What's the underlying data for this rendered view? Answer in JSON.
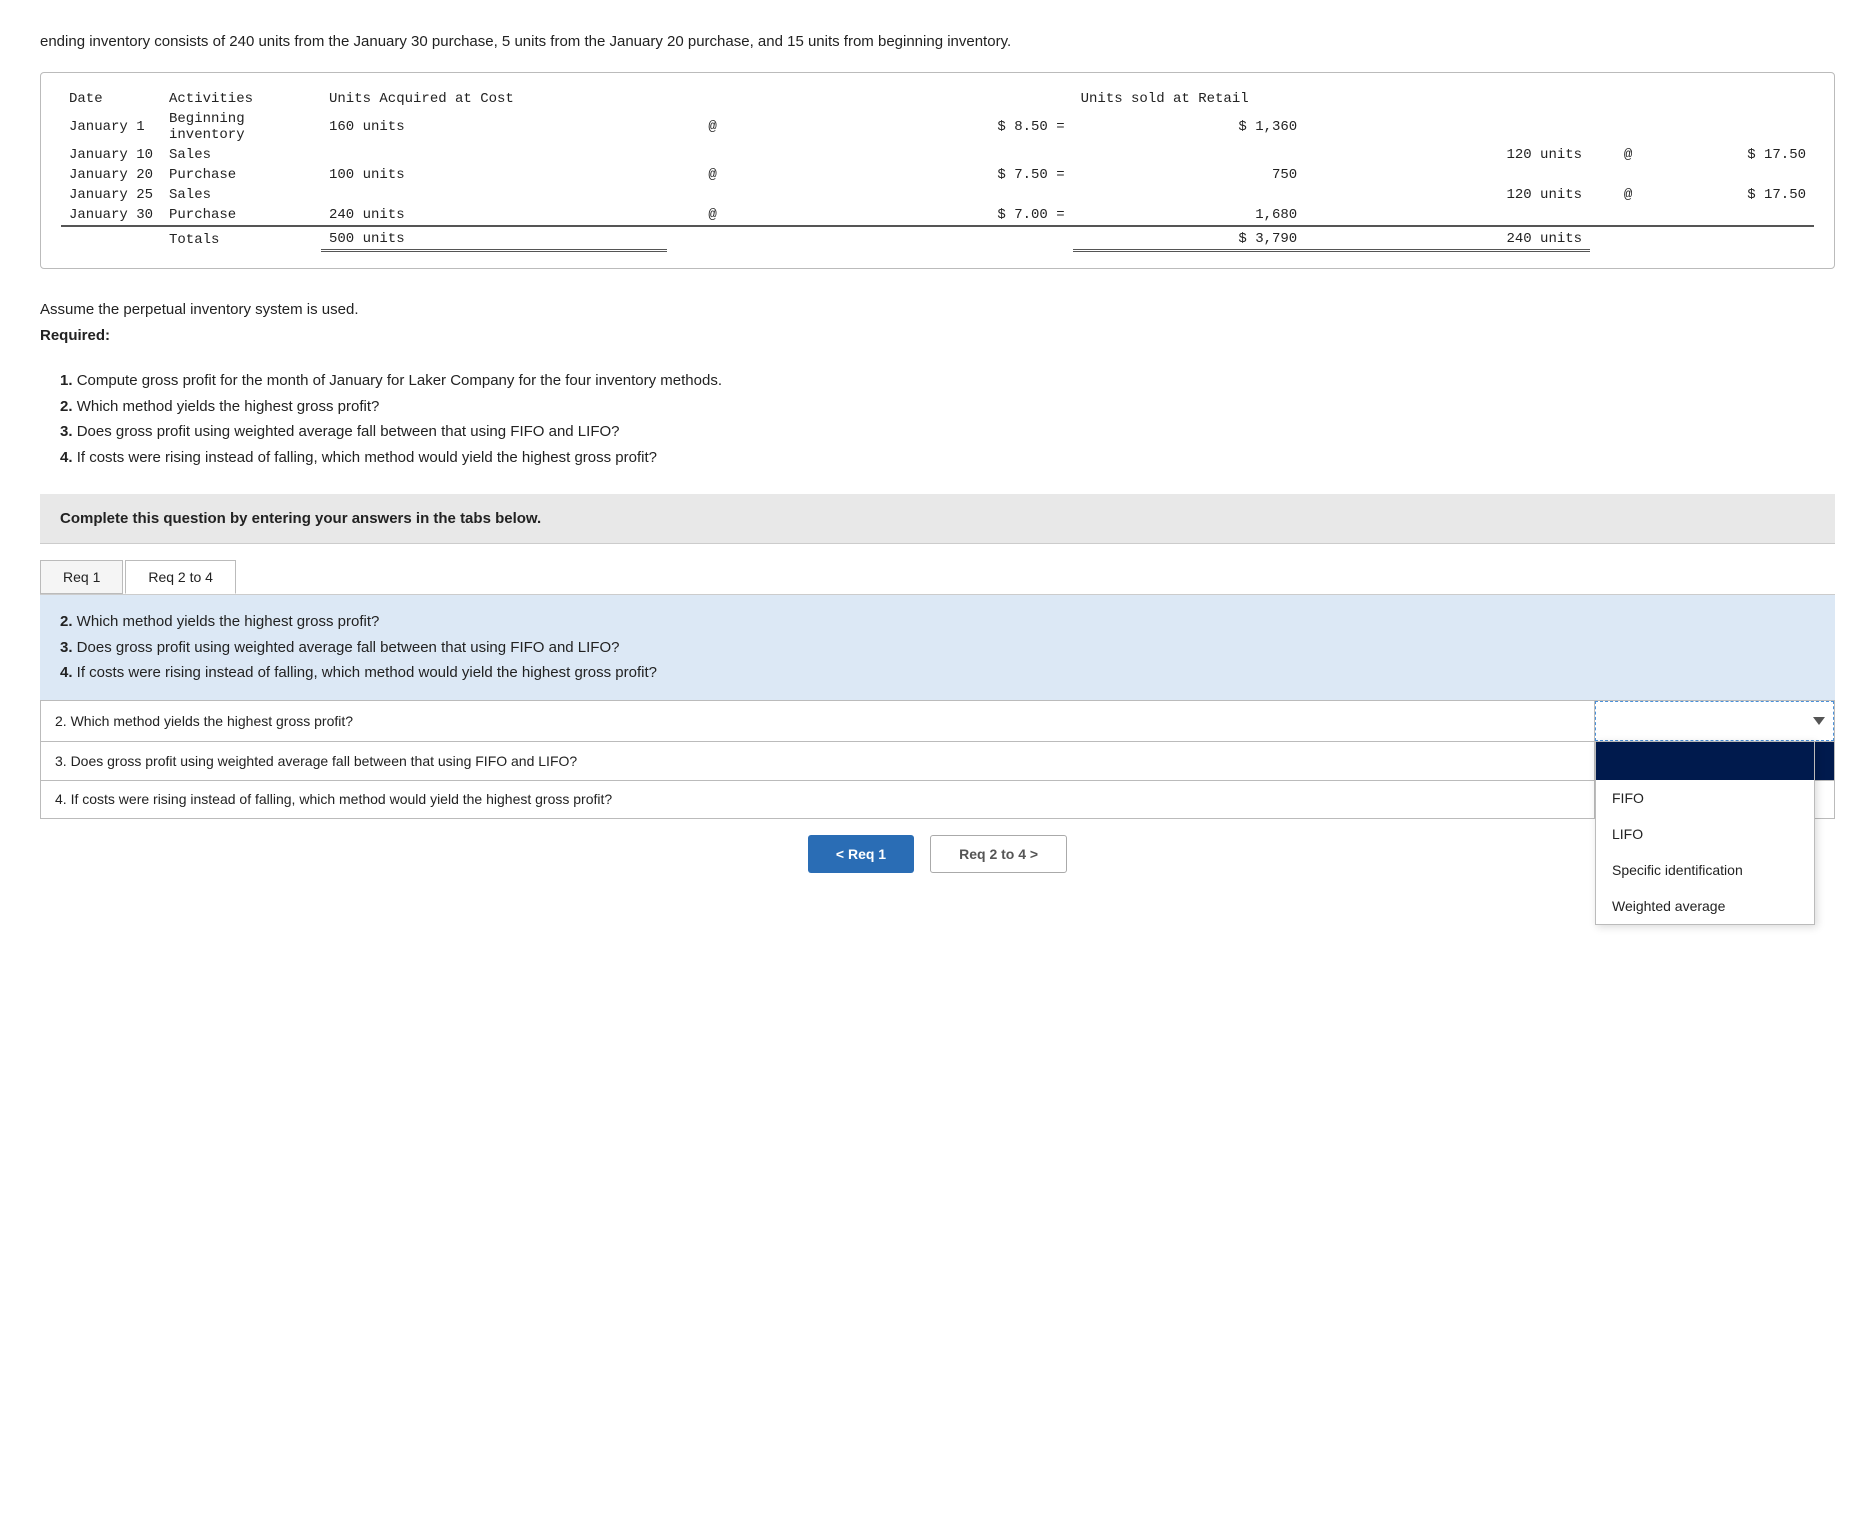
{
  "intro": {
    "text": "ending inventory consists of 240 units from the January 30 purchase, 5 units from the January 20 purchase, and 15 units from beginning inventory."
  },
  "table": {
    "headers": {
      "date": "Date",
      "activities": "Activities",
      "acquired": "Units Acquired at Cost",
      "sold": "Units sold at Retail"
    },
    "rows": [
      {
        "date": "January 1",
        "activity": "Beginning inventory",
        "acquired_units": "160 units",
        "acquired_at": "@",
        "acquired_price": "$ 8.50 =",
        "acquired_total": "$ 1,360",
        "sold_units": "",
        "sold_at": "",
        "sold_price": ""
      },
      {
        "date": "January 10",
        "activity": "Sales",
        "acquired_units": "",
        "acquired_at": "",
        "acquired_price": "",
        "acquired_total": "",
        "sold_units": "120 units",
        "sold_at": "@",
        "sold_price": "$ 17.50"
      },
      {
        "date": "January 20",
        "activity": "Purchase",
        "acquired_units": "100 units",
        "acquired_at": "@",
        "acquired_price": "$ 7.50 =",
        "acquired_total": "750",
        "sold_units": "",
        "sold_at": "",
        "sold_price": ""
      },
      {
        "date": "January 25",
        "activity": "Sales",
        "acquired_units": "",
        "acquired_at": "",
        "acquired_price": "",
        "acquired_total": "",
        "sold_units": "120 units",
        "sold_at": "@",
        "sold_price": "$ 17.50"
      },
      {
        "date": "January 30",
        "activity": "Purchase",
        "acquired_units": "240 units",
        "acquired_at": "@",
        "acquired_price": "$ 7.00 =",
        "acquired_total": "1,680",
        "sold_units": "",
        "sold_at": "",
        "sold_price": ""
      }
    ],
    "totals": {
      "label": "Totals",
      "acquired_units": "500 units",
      "acquired_total": "$ 3,790",
      "sold_units": "240 units"
    }
  },
  "assume": {
    "text": "Assume the perpetual inventory system is used.",
    "required_label": "Required:"
  },
  "required_items": [
    {
      "num": "1.",
      "text": "Compute gross profit for the month of January for Laker Company for the four inventory methods."
    },
    {
      "num": "2.",
      "text": "Which method yields the highest gross profit?"
    },
    {
      "num": "3.",
      "text": "Does gross profit using weighted average fall between that using FIFO and LIFO?"
    },
    {
      "num": "4.",
      "text": "If costs were rising instead of falling, which method would yield the highest gross profit?"
    }
  ],
  "complete_box": {
    "text": "Complete this question by entering your answers in the tabs below."
  },
  "tabs": [
    {
      "label": "Req 1",
      "id": "req1",
      "active": false
    },
    {
      "label": "Req 2 to 4",
      "id": "req2to4",
      "active": true
    }
  ],
  "blue_instruction": {
    "lines": [
      "2. Which method yields the highest gross profit?",
      "3. Does gross profit using weighted average fall between that using FIFO and LIFO?",
      "4. If costs were rising instead of falling, which method would yield the highest gross profit?"
    ]
  },
  "questions": [
    {
      "id": "q2",
      "text": "2. Which method yields the highest gross profit?"
    },
    {
      "id": "q3",
      "text": "3. Does gross profit using weighted average fall between that using FIFO and LIFO?"
    },
    {
      "id": "q4",
      "text": "4. If costs were rising instead of falling, which method would yield the highest gross profit?"
    }
  ],
  "dropdown_options": [
    {
      "id": "fifo",
      "label": "FIFO"
    },
    {
      "id": "lifo",
      "label": "LIFO"
    },
    {
      "id": "specific",
      "label": "Specific identification"
    },
    {
      "id": "weighted",
      "label": "Weighted average"
    }
  ],
  "nav_buttons": {
    "prev_label": "< Req 1",
    "next_label": "Req 2 to 4 >"
  },
  "colors": {
    "dark_blue": "#001a4d",
    "button_blue": "#2a6db5",
    "light_blue_bg": "#dce8f5"
  }
}
